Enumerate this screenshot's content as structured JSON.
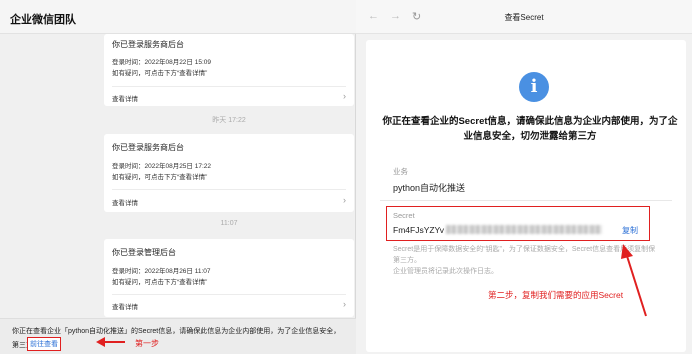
{
  "left": {
    "title": "企业微信团队",
    "cards": [
      {
        "title": "你已登录服务商后台",
        "time_line": "登录时间：2022年08月22日 15:09",
        "hint_line": "如有疑问，可点击下方“查看详情”",
        "detail": "查看详情"
      },
      {
        "title": "你已登录服务商后台",
        "time_line": "登录时间：2022年08月25日 17:22",
        "hint_line": "如有疑问，可点击下方“查看详情”",
        "detail": "查看详情"
      },
      {
        "title": "你已登录管理后台",
        "time_line": "登录时间：2022年08月26日 11:07",
        "hint_line": "如有疑问，可点击下方“查看详情”",
        "detail": "查看详情"
      }
    ],
    "separators": [
      "昨天 17:22",
      "11:07"
    ],
    "bottom_message": "你正在查看企业「python自动化推送」的Secret信息，请确保此信息为企业内部使用，为了企业信息安全，",
    "bottom_message_2": "第三方。",
    "goto_link": "前往查看",
    "step1": "第一步"
  },
  "right": {
    "page_title": "查看Secret",
    "info_icon": "i",
    "warning": "你正在查看企业的Secret信息，请确保此信息为企业内部使用，为了企业信息安全，切勿泄露给第三方",
    "business_label": "业务",
    "business_value": "python自动化推送",
    "secret_label": "Secret",
    "secret_prefix": "Fm4FJsYZYv",
    "copy": "复制",
    "note_1": "Secret是用于保障数据安全的“钥匙”，为了保证数据安全，Secret信息查看后须复制保",
    "note_2": "第三方。",
    "note_3": "企业管理员将记录此次操作日志。",
    "step2": "第二步，复制我们需要的应用Secret"
  },
  "colors": {
    "annotation_red": "#e02020",
    "link_blue": "#2a6fd6",
    "info_blue": "#4a90e2"
  }
}
